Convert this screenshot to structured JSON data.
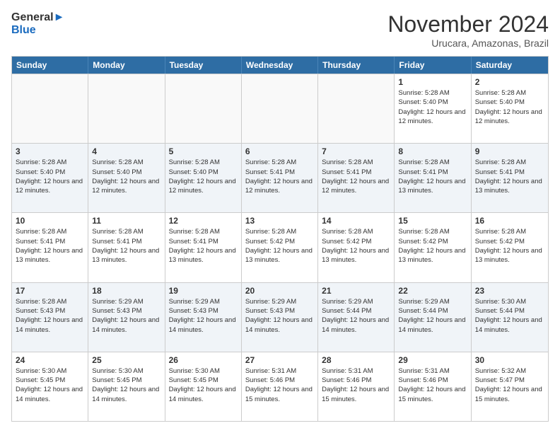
{
  "logo": {
    "general": "General",
    "blue": "Blue"
  },
  "header": {
    "month": "November 2024",
    "location": "Urucara, Amazonas, Brazil"
  },
  "weekdays": [
    "Sunday",
    "Monday",
    "Tuesday",
    "Wednesday",
    "Thursday",
    "Friday",
    "Saturday"
  ],
  "weeks": [
    [
      {
        "day": "",
        "empty": true
      },
      {
        "day": "",
        "empty": true
      },
      {
        "day": "",
        "empty": true
      },
      {
        "day": "",
        "empty": true
      },
      {
        "day": "",
        "empty": true
      },
      {
        "day": "1",
        "sunrise": "5:28 AM",
        "sunset": "5:40 PM",
        "daylight": "12 hours and 12 minutes."
      },
      {
        "day": "2",
        "sunrise": "5:28 AM",
        "sunset": "5:40 PM",
        "daylight": "12 hours and 12 minutes."
      }
    ],
    [
      {
        "day": "3",
        "sunrise": "5:28 AM",
        "sunset": "5:40 PM",
        "daylight": "12 hours and 12 minutes."
      },
      {
        "day": "4",
        "sunrise": "5:28 AM",
        "sunset": "5:40 PM",
        "daylight": "12 hours and 12 minutes."
      },
      {
        "day": "5",
        "sunrise": "5:28 AM",
        "sunset": "5:40 PM",
        "daylight": "12 hours and 12 minutes."
      },
      {
        "day": "6",
        "sunrise": "5:28 AM",
        "sunset": "5:41 PM",
        "daylight": "12 hours and 12 minutes."
      },
      {
        "day": "7",
        "sunrise": "5:28 AM",
        "sunset": "5:41 PM",
        "daylight": "12 hours and 12 minutes."
      },
      {
        "day": "8",
        "sunrise": "5:28 AM",
        "sunset": "5:41 PM",
        "daylight": "12 hours and 13 minutes."
      },
      {
        "day": "9",
        "sunrise": "5:28 AM",
        "sunset": "5:41 PM",
        "daylight": "12 hours and 13 minutes."
      }
    ],
    [
      {
        "day": "10",
        "sunrise": "5:28 AM",
        "sunset": "5:41 PM",
        "daylight": "12 hours and 13 minutes."
      },
      {
        "day": "11",
        "sunrise": "5:28 AM",
        "sunset": "5:41 PM",
        "daylight": "12 hours and 13 minutes."
      },
      {
        "day": "12",
        "sunrise": "5:28 AM",
        "sunset": "5:41 PM",
        "daylight": "12 hours and 13 minutes."
      },
      {
        "day": "13",
        "sunrise": "5:28 AM",
        "sunset": "5:42 PM",
        "daylight": "12 hours and 13 minutes."
      },
      {
        "day": "14",
        "sunrise": "5:28 AM",
        "sunset": "5:42 PM",
        "daylight": "12 hours and 13 minutes."
      },
      {
        "day": "15",
        "sunrise": "5:28 AM",
        "sunset": "5:42 PM",
        "daylight": "12 hours and 13 minutes."
      },
      {
        "day": "16",
        "sunrise": "5:28 AM",
        "sunset": "5:42 PM",
        "daylight": "12 hours and 13 minutes."
      }
    ],
    [
      {
        "day": "17",
        "sunrise": "5:28 AM",
        "sunset": "5:43 PM",
        "daylight": "12 hours and 14 minutes."
      },
      {
        "day": "18",
        "sunrise": "5:29 AM",
        "sunset": "5:43 PM",
        "daylight": "12 hours and 14 minutes."
      },
      {
        "day": "19",
        "sunrise": "5:29 AM",
        "sunset": "5:43 PM",
        "daylight": "12 hours and 14 minutes."
      },
      {
        "day": "20",
        "sunrise": "5:29 AM",
        "sunset": "5:43 PM",
        "daylight": "12 hours and 14 minutes."
      },
      {
        "day": "21",
        "sunrise": "5:29 AM",
        "sunset": "5:44 PM",
        "daylight": "12 hours and 14 minutes."
      },
      {
        "day": "22",
        "sunrise": "5:29 AM",
        "sunset": "5:44 PM",
        "daylight": "12 hours and 14 minutes."
      },
      {
        "day": "23",
        "sunrise": "5:30 AM",
        "sunset": "5:44 PM",
        "daylight": "12 hours and 14 minutes."
      }
    ],
    [
      {
        "day": "24",
        "sunrise": "5:30 AM",
        "sunset": "5:45 PM",
        "daylight": "12 hours and 14 minutes."
      },
      {
        "day": "25",
        "sunrise": "5:30 AM",
        "sunset": "5:45 PM",
        "daylight": "12 hours and 14 minutes."
      },
      {
        "day": "26",
        "sunrise": "5:30 AM",
        "sunset": "5:45 PM",
        "daylight": "12 hours and 14 minutes."
      },
      {
        "day": "27",
        "sunrise": "5:31 AM",
        "sunset": "5:46 PM",
        "daylight": "12 hours and 15 minutes."
      },
      {
        "day": "28",
        "sunrise": "5:31 AM",
        "sunset": "5:46 PM",
        "daylight": "12 hours and 15 minutes."
      },
      {
        "day": "29",
        "sunrise": "5:31 AM",
        "sunset": "5:46 PM",
        "daylight": "12 hours and 15 minutes."
      },
      {
        "day": "30",
        "sunrise": "5:32 AM",
        "sunset": "5:47 PM",
        "daylight": "12 hours and 15 minutes."
      }
    ]
  ]
}
